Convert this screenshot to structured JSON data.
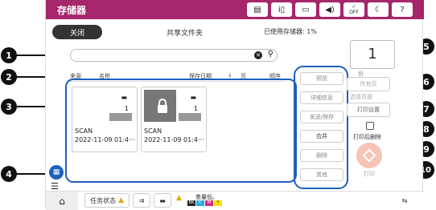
{
  "window": {
    "title": "存储器",
    "status_icons": [
      "document-icon",
      "info-icon",
      "wifi-icon",
      "volume-icon",
      "wifi-off-icon",
      "night-mode-icon",
      "help-icon"
    ],
    "wifi_off_text": "OFF"
  },
  "tabs": {
    "close_label": "关闭",
    "shared_folder_label": "共享文件夹",
    "storage_used": "已使用存储器: 1%"
  },
  "search": {
    "placeholder": ""
  },
  "table_header": {
    "source": "来源",
    "name": "名称",
    "saved_date": "保存日期",
    "sort_arrow": "↓",
    "page": "页",
    "order": "顺序"
  },
  "documents": [
    {
      "name": "SCAN",
      "date": "2022-11-09 01:4···",
      "count": "1",
      "locked": false
    },
    {
      "name": "SCAN",
      "date": "2022-11-09 01:4···",
      "count": "1",
      "locked": true
    }
  ],
  "action_panel": {
    "items": [
      "预览",
      "详细信息",
      "发送/保存",
      "合并",
      "删除",
      "其他"
    ]
  },
  "print_settings": {
    "copies": "1",
    "copies_label": "份",
    "all_pages_label": "所有页",
    "select_pages_label": "选择页面",
    "print_settings_label": "打印设置",
    "delete_after_print_label": "打印后删除",
    "start_label": "打印"
  },
  "bottom_bar": {
    "job_status_label": "任务状态",
    "ink_label": "墨量低。",
    "ink_colors": [
      "BK",
      "C",
      "M",
      "Y"
    ]
  },
  "callouts": [
    "1",
    "2",
    "3",
    "4",
    "5",
    "6",
    "7",
    "8",
    "9",
    "10"
  ],
  "colors": {
    "titlebar": "#a6266b",
    "highlight": "#1f5fbf",
    "callout": "#111111"
  }
}
